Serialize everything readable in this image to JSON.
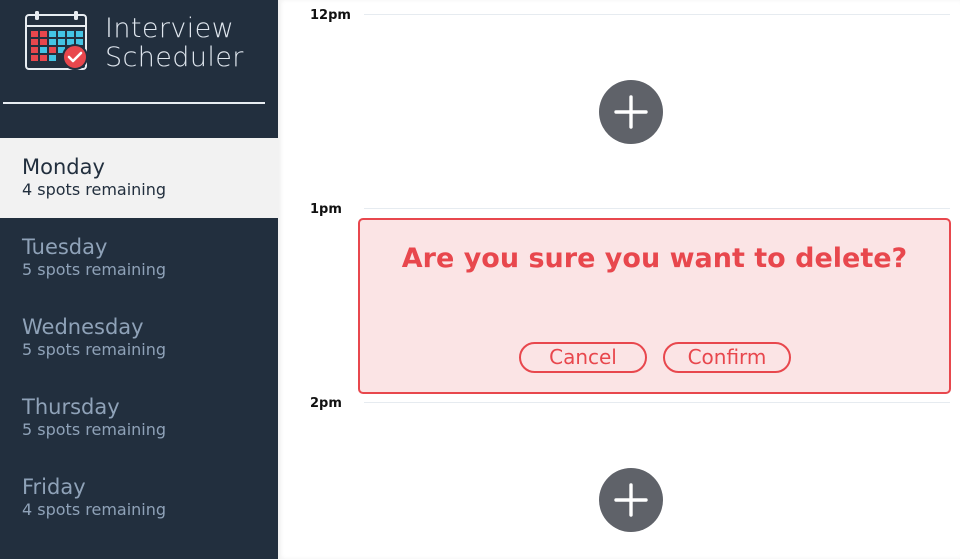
{
  "sidebar": {
    "brand": {
      "title_line1": "Interview",
      "title_line2": "Scheduler"
    },
    "days": [
      {
        "name": "Monday",
        "spots": "4 spots remaining",
        "selected": true
      },
      {
        "name": "Tuesday",
        "spots": "5 spots remaining",
        "selected": false
      },
      {
        "name": "Wednesday",
        "spots": "5 spots remaining",
        "selected": false
      },
      {
        "name": "Thursday",
        "spots": "5 spots remaining",
        "selected": false
      },
      {
        "name": "Friday",
        "spots": "4 spots remaining",
        "selected": false
      }
    ]
  },
  "schedule": {
    "times": [
      "12pm",
      "1pm",
      "2pm"
    ],
    "confirm": {
      "message": "Are you sure you want to delete?",
      "cancel_label": "Cancel",
      "confirm_label": "Confirm"
    }
  },
  "colors": {
    "sidebar_bg": "#222f3e",
    "selected_bg": "#f2f2f2",
    "danger": "#e8474d",
    "danger_bg": "#fbe4e5",
    "add_button": "#5f6269"
  },
  "icons": {
    "logo": "calendar-check-icon",
    "add": "plus-icon"
  }
}
